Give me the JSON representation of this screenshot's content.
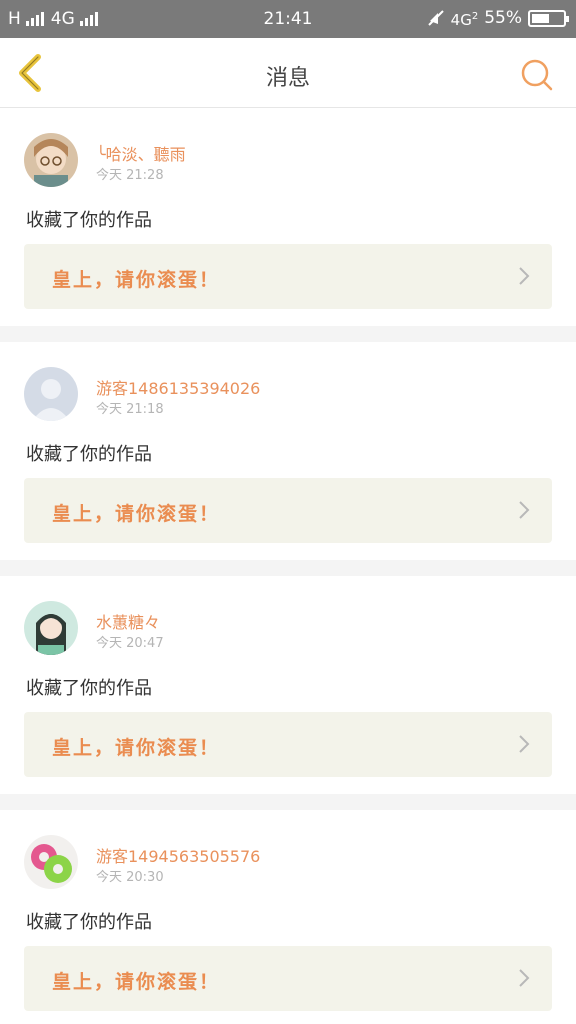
{
  "status_bar": {
    "carrier_left": "H",
    "network_left": "4G",
    "time": "21:41",
    "network_right": "4G",
    "network_right_sub": "2",
    "battery": "55%",
    "battery_level": 0.55
  },
  "header": {
    "title": "消息",
    "back_icon": "chevron-left-icon",
    "search_icon": "search-icon"
  },
  "messages": [
    {
      "username": "╰哈淡、聽雨",
      "time": "今天 21:28",
      "action": "收藏了你的作品",
      "quote": "皇上，请你滚蛋！",
      "avatar": "anime-girl-glasses"
    },
    {
      "username": "游客1486135394026",
      "time": "今天 21:18",
      "action": "收藏了你的作品",
      "quote": "皇上，请你滚蛋！",
      "avatar": "default-user"
    },
    {
      "username": "水蕙糖々",
      "time": "今天 20:47",
      "action": "收藏了你的作品",
      "quote": "皇上，请你滚蛋！",
      "avatar": "anime-girl-green"
    },
    {
      "username": "游客1494563505576",
      "time": "今天 20:30",
      "action": "收藏了你的作品",
      "quote": "皇上，请你滚蛋！",
      "avatar": "donut-rings"
    }
  ],
  "colors": {
    "accent": "#e9915c",
    "status_bar": "#7a7a7a",
    "quote_bg": "#f3f3ea",
    "back_arrow": "#e8c43c"
  }
}
